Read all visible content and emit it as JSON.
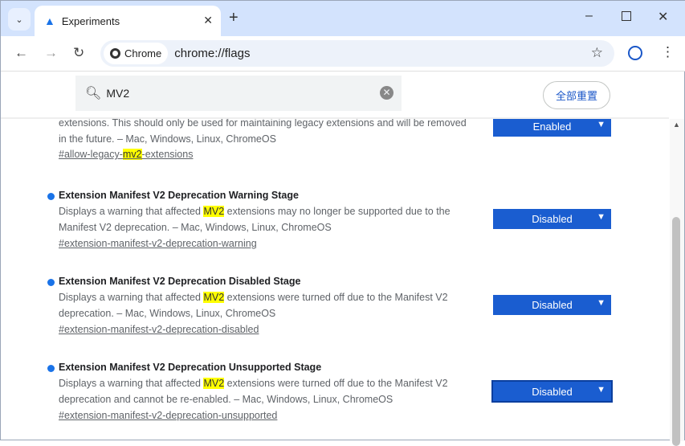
{
  "tab": {
    "title": "Experiments",
    "icon": "flask-icon"
  },
  "toolbar": {
    "chip_label": "Chrome",
    "url": "chrome://flags"
  },
  "search": {
    "value": "MV2",
    "reset_label": "全部重置"
  },
  "colors": {
    "accent": "#1a5dd0",
    "highlight": "#ffff00",
    "tabstrip": "#d3e3fd"
  },
  "flags": [
    {
      "desc_pre": "extensions. This should only be used for maintaining legacy extensions and will be removed in the future. – Mac, Windows, Linux, ChromeOS",
      "link_pre": "#allow-legacy-",
      "link_hl": "mv2",
      "link_post": "-extensions",
      "state": "Enabled"
    },
    {
      "title": "Extension Manifest V2 Deprecation Warning Stage",
      "desc_pre": "Displays a warning that affected ",
      "hl": "MV2",
      "desc_post": " extensions may no longer be supported due to the Manifest V2 deprecation. – Mac, Windows, Linux, ChromeOS",
      "link": "#extension-manifest-v2-deprecation-warning",
      "state": "Disabled"
    },
    {
      "title": "Extension Manifest V2 Deprecation Disabled Stage",
      "desc_pre": "Displays a warning that affected ",
      "hl": "MV2",
      "desc_post": " extensions were turned off due to the Manifest V2 deprecation. – Mac, Windows, Linux, ChromeOS",
      "link": "#extension-manifest-v2-deprecation-disabled",
      "state": "Disabled"
    },
    {
      "title": "Extension Manifest V2 Deprecation Unsupported Stage",
      "desc_pre": "Displays a warning that affected ",
      "hl": "MV2",
      "desc_post": " extensions were turned off due to the Manifest V2 deprecation and cannot be re-enabled. – Mac, Windows, Linux, ChromeOS",
      "link": "#extension-manifest-v2-deprecation-unsupported",
      "state": "Disabled"
    }
  ]
}
